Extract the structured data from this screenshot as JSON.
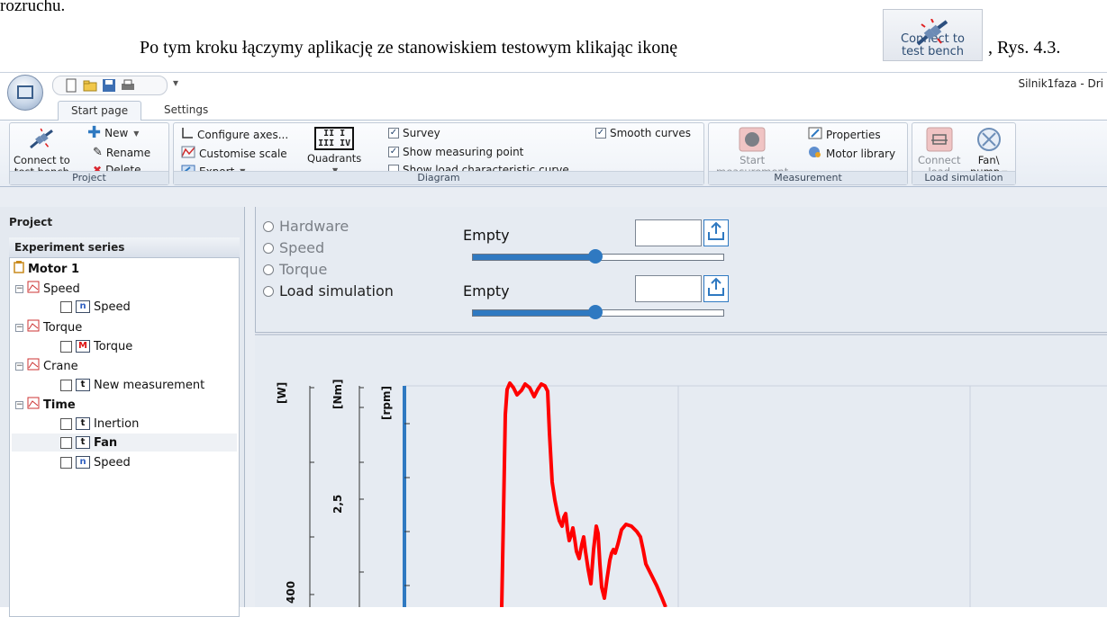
{
  "document": {
    "fragment_top": "rozruchu.",
    "line_text": "Po tym kroku łączymy aplikację ze stanowiskiem testowym klikając ikonę",
    "inline_button_label_1": "Connect to",
    "inline_button_label_2": "test bench",
    "line_suffix": ", Rys. 4.3."
  },
  "app": {
    "title": "Silnik1faza - Dri",
    "tabs": [
      "Start page",
      "Settings"
    ],
    "ribbon": {
      "project": {
        "label": "Project",
        "connect_1": "Connect to",
        "connect_2": "test bench",
        "new": "New",
        "rename": "Rename",
        "delete": "Delete"
      },
      "diagram": {
        "label": "Diagram",
        "configure_axes": "Configure axes...",
        "customise_scale": "Customise scale",
        "export": "Export",
        "quadrants": "Quadrants",
        "quadrant_glyph_top": "II I",
        "quadrant_glyph_bottom": "III IV",
        "survey": "Survey",
        "show_measuring_point": "Show measuring point",
        "show_load_curve": "Show load characteristic curve",
        "smooth_curves": "Smooth curves",
        "checks": {
          "survey": true,
          "show_measuring_point": true,
          "show_load_curve": false,
          "smooth_curves": true
        }
      },
      "measurement": {
        "label": "Measurement",
        "start_1": "Start",
        "start_2": "measurement",
        "properties": "Properties",
        "motor_library": "Motor library"
      },
      "load_simulation": {
        "label": "Load simulation",
        "connect_1": "Connect",
        "connect_2": "load",
        "fan_1": "Fan\\",
        "fan_2": "pump"
      }
    }
  },
  "pane": {
    "title": "Project",
    "series_header": "Experiment series",
    "tree": {
      "root": "Motor 1",
      "speed_group": "Speed",
      "speed_item": "Speed",
      "torque_group": "Torque",
      "torque_item": "Torque",
      "crane_group": "Crane",
      "crane_item": "New measurement",
      "time_group": "Time",
      "time_item_1": "Inertion",
      "time_item_2": "Fan",
      "time_item_3": "Speed",
      "badge_n": "n",
      "badge_m": "M",
      "badge_t": "t"
    }
  },
  "controls": {
    "modes": [
      "Hardware",
      "Speed",
      "Torque",
      "Load simulation"
    ],
    "slider1": {
      "label": "Empty",
      "value": 0.49
    },
    "slider2": {
      "label": "Empty",
      "value": 0.49
    }
  },
  "chart_data": {
    "type": "line",
    "y_axis_labels": [
      "[W]",
      "[Nm]",
      "[rpm]"
    ],
    "tick_labels": [
      "2,5",
      "400"
    ],
    "series": [
      {
        "color": "#ff0000"
      }
    ],
    "grid": true
  },
  "colors": {
    "accent_blue": "#2f79c1",
    "curve_red": "#ff0000",
    "ribbon_bg": "#e8edf4"
  }
}
